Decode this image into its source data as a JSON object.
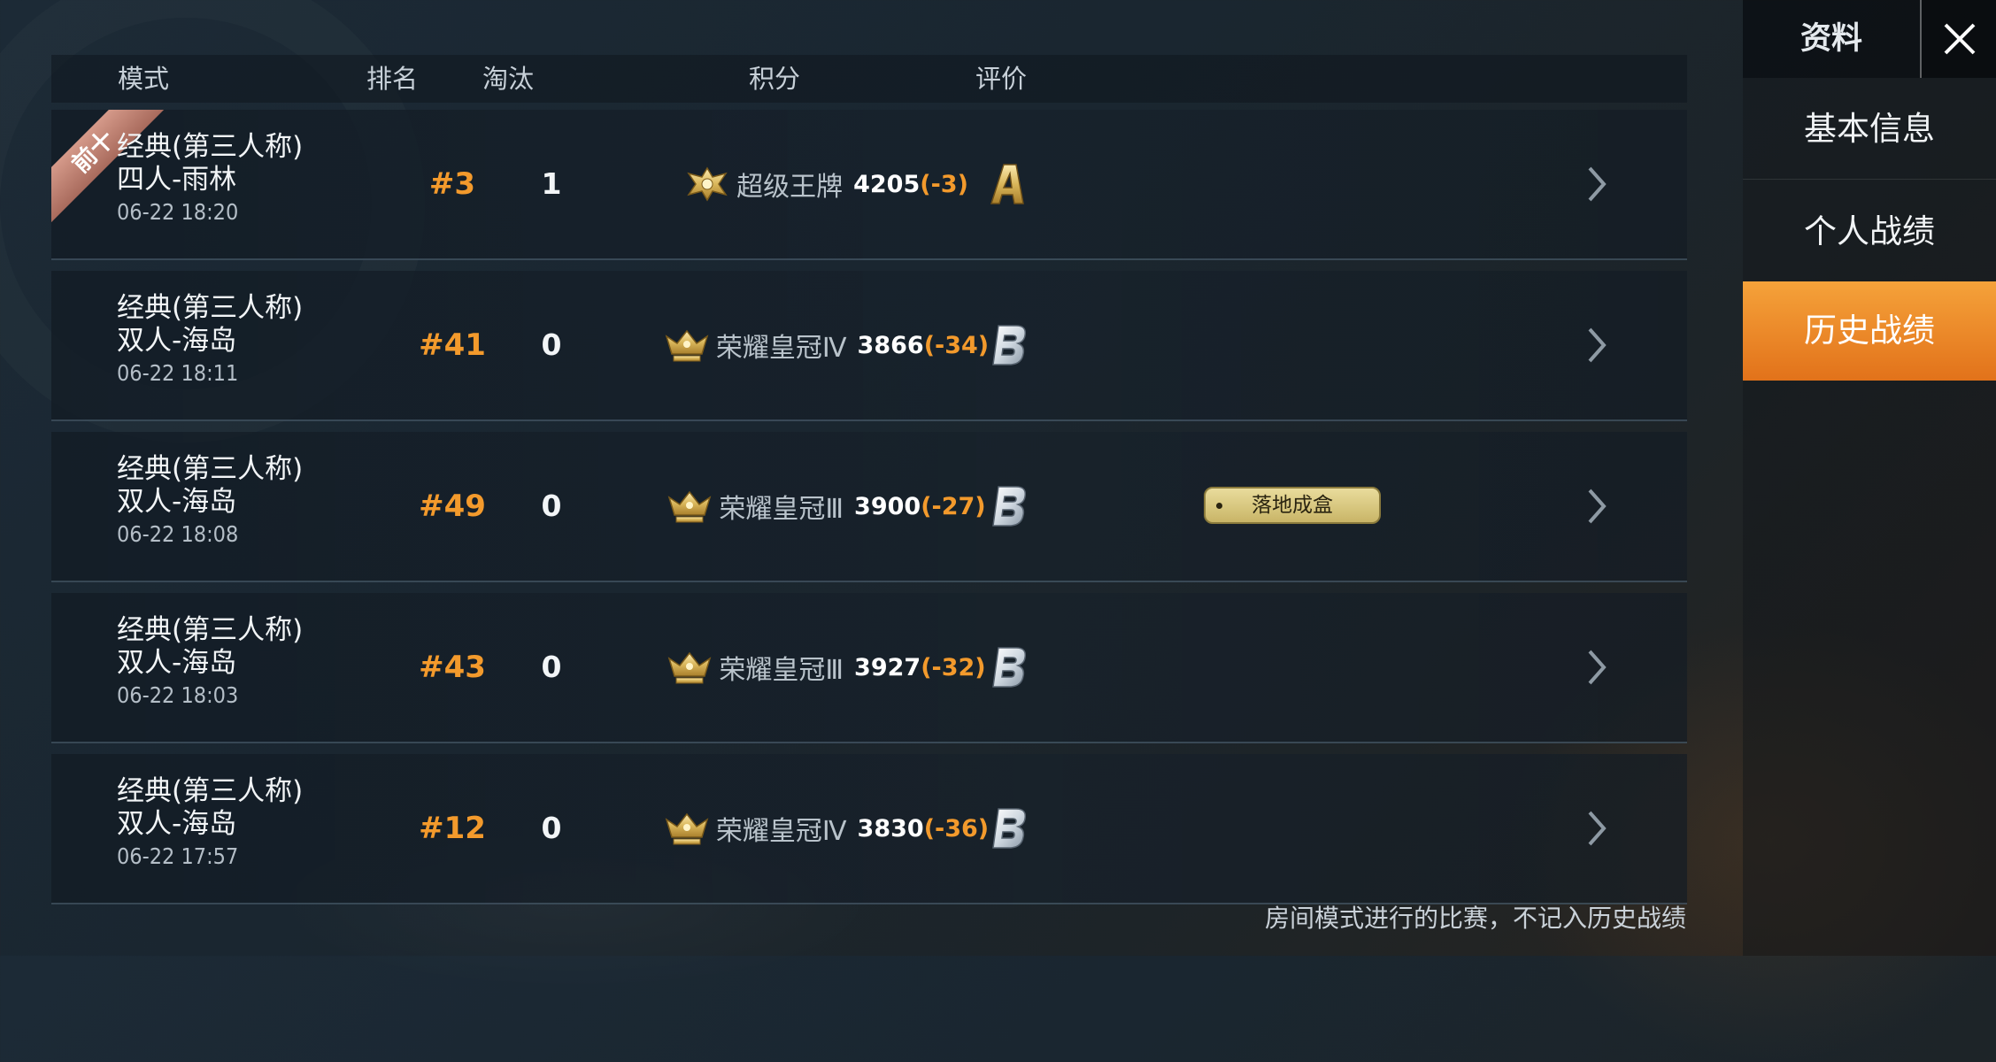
{
  "header": {
    "mode": "模式",
    "rank": "排名",
    "kills": "淘汰",
    "score": "积分",
    "rating": "评价"
  },
  "matches": [
    {
      "mode_line1": "经典(第三人称)",
      "mode_line2": "四人-雨林",
      "time": "06-22 18:20",
      "rank": "#3",
      "kills": "1",
      "tier": "超级王牌",
      "tier_icon": "ace-emblem-icon",
      "score": "4205",
      "delta": "(-3)",
      "grade": "A",
      "top10_label": "前十"
    },
    {
      "mode_line1": "经典(第三人称)",
      "mode_line2": "双人-海岛",
      "time": "06-22 18:11",
      "rank": "#41",
      "kills": "0",
      "tier": "荣耀皇冠Ⅳ",
      "tier_icon": "crown-emblem-icon",
      "score": "3866",
      "delta": "(-34)",
      "grade": "B"
    },
    {
      "mode_line1": "经典(第三人称)",
      "mode_line2": "双人-海岛",
      "time": "06-22 18:08",
      "rank": "#49",
      "kills": "0",
      "tier": "荣耀皇冠Ⅲ",
      "tier_icon": "crown-emblem-icon",
      "score": "3900",
      "delta": "(-27)",
      "grade": "B",
      "badge": "落地成盒"
    },
    {
      "mode_line1": "经典(第三人称)",
      "mode_line2": "双人-海岛",
      "time": "06-22 18:03",
      "rank": "#43",
      "kills": "0",
      "tier": "荣耀皇冠Ⅲ",
      "tier_icon": "crown-emblem-icon",
      "score": "3927",
      "delta": "(-32)",
      "grade": "B"
    },
    {
      "mode_line1": "经典(第三人称)",
      "mode_line2": "双人-海岛",
      "time": "06-22 17:57",
      "rank": "#12",
      "kills": "0",
      "tier": "荣耀皇冠Ⅳ",
      "tier_icon": "crown-emblem-icon",
      "score": "3830",
      "delta": "(-36)",
      "grade": "B"
    }
  ],
  "footnote": "房间模式进行的比赛，不记入历史战绩",
  "sidebar": {
    "title": "资料",
    "items": [
      {
        "label": "基本信息",
        "active": false
      },
      {
        "label": "个人战绩",
        "active": false
      },
      {
        "label": "历史战绩",
        "active": true
      }
    ]
  },
  "colors": {
    "accent_orange": "#f39a2c",
    "active_tab": "#ec8a28",
    "badge_gold": "#d9c87e",
    "top10_ribbon": "#c08473"
  }
}
